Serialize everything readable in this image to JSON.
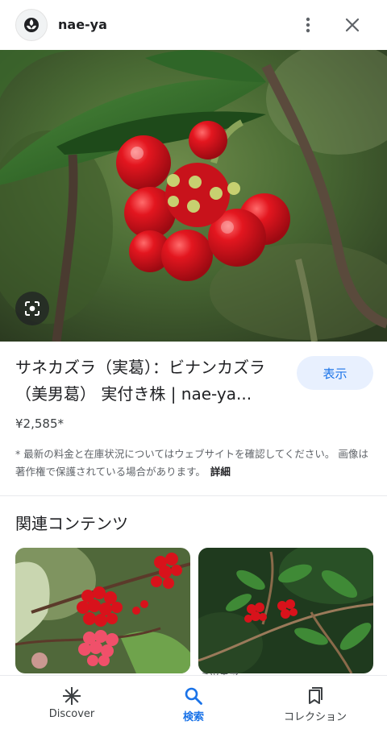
{
  "header": {
    "site_name": "nae-ya",
    "logo_icon": "plant-logo-icon",
    "more_icon": "more-vert-icon",
    "close_icon": "close-icon"
  },
  "hero_image": {
    "description_icon": "red-berries-photo",
    "lens_icon": "lens-icon"
  },
  "result": {
    "title": "サネカズラ（実葛）：ビナンカズラ（美男葛） 実付き株 | nae-ya...",
    "view_label": "表示",
    "price": "¥2,585*",
    "notice": "* 最新の料金と在庫状況についてはウェブサイトを確認してください。 画像は著作権で保護されている場合があります。",
    "details_label": "詳細"
  },
  "related": {
    "heading": "関連コンテンツ",
    "items": [
      {
        "source": ""
      },
      {
        "source": "ミツエア"
      }
    ]
  },
  "bottom_nav": {
    "items": [
      {
        "label": "Discover",
        "icon": "asterisk-icon"
      },
      {
        "label": "検索",
        "icon": "search-icon"
      },
      {
        "label": "コレクション",
        "icon": "bookmarks-icon"
      }
    ],
    "active_index": 1
  },
  "colors": {
    "accent": "#1a73e8",
    "accent_bg": "#e8f0fe",
    "berry_red": "#d0121b"
  }
}
